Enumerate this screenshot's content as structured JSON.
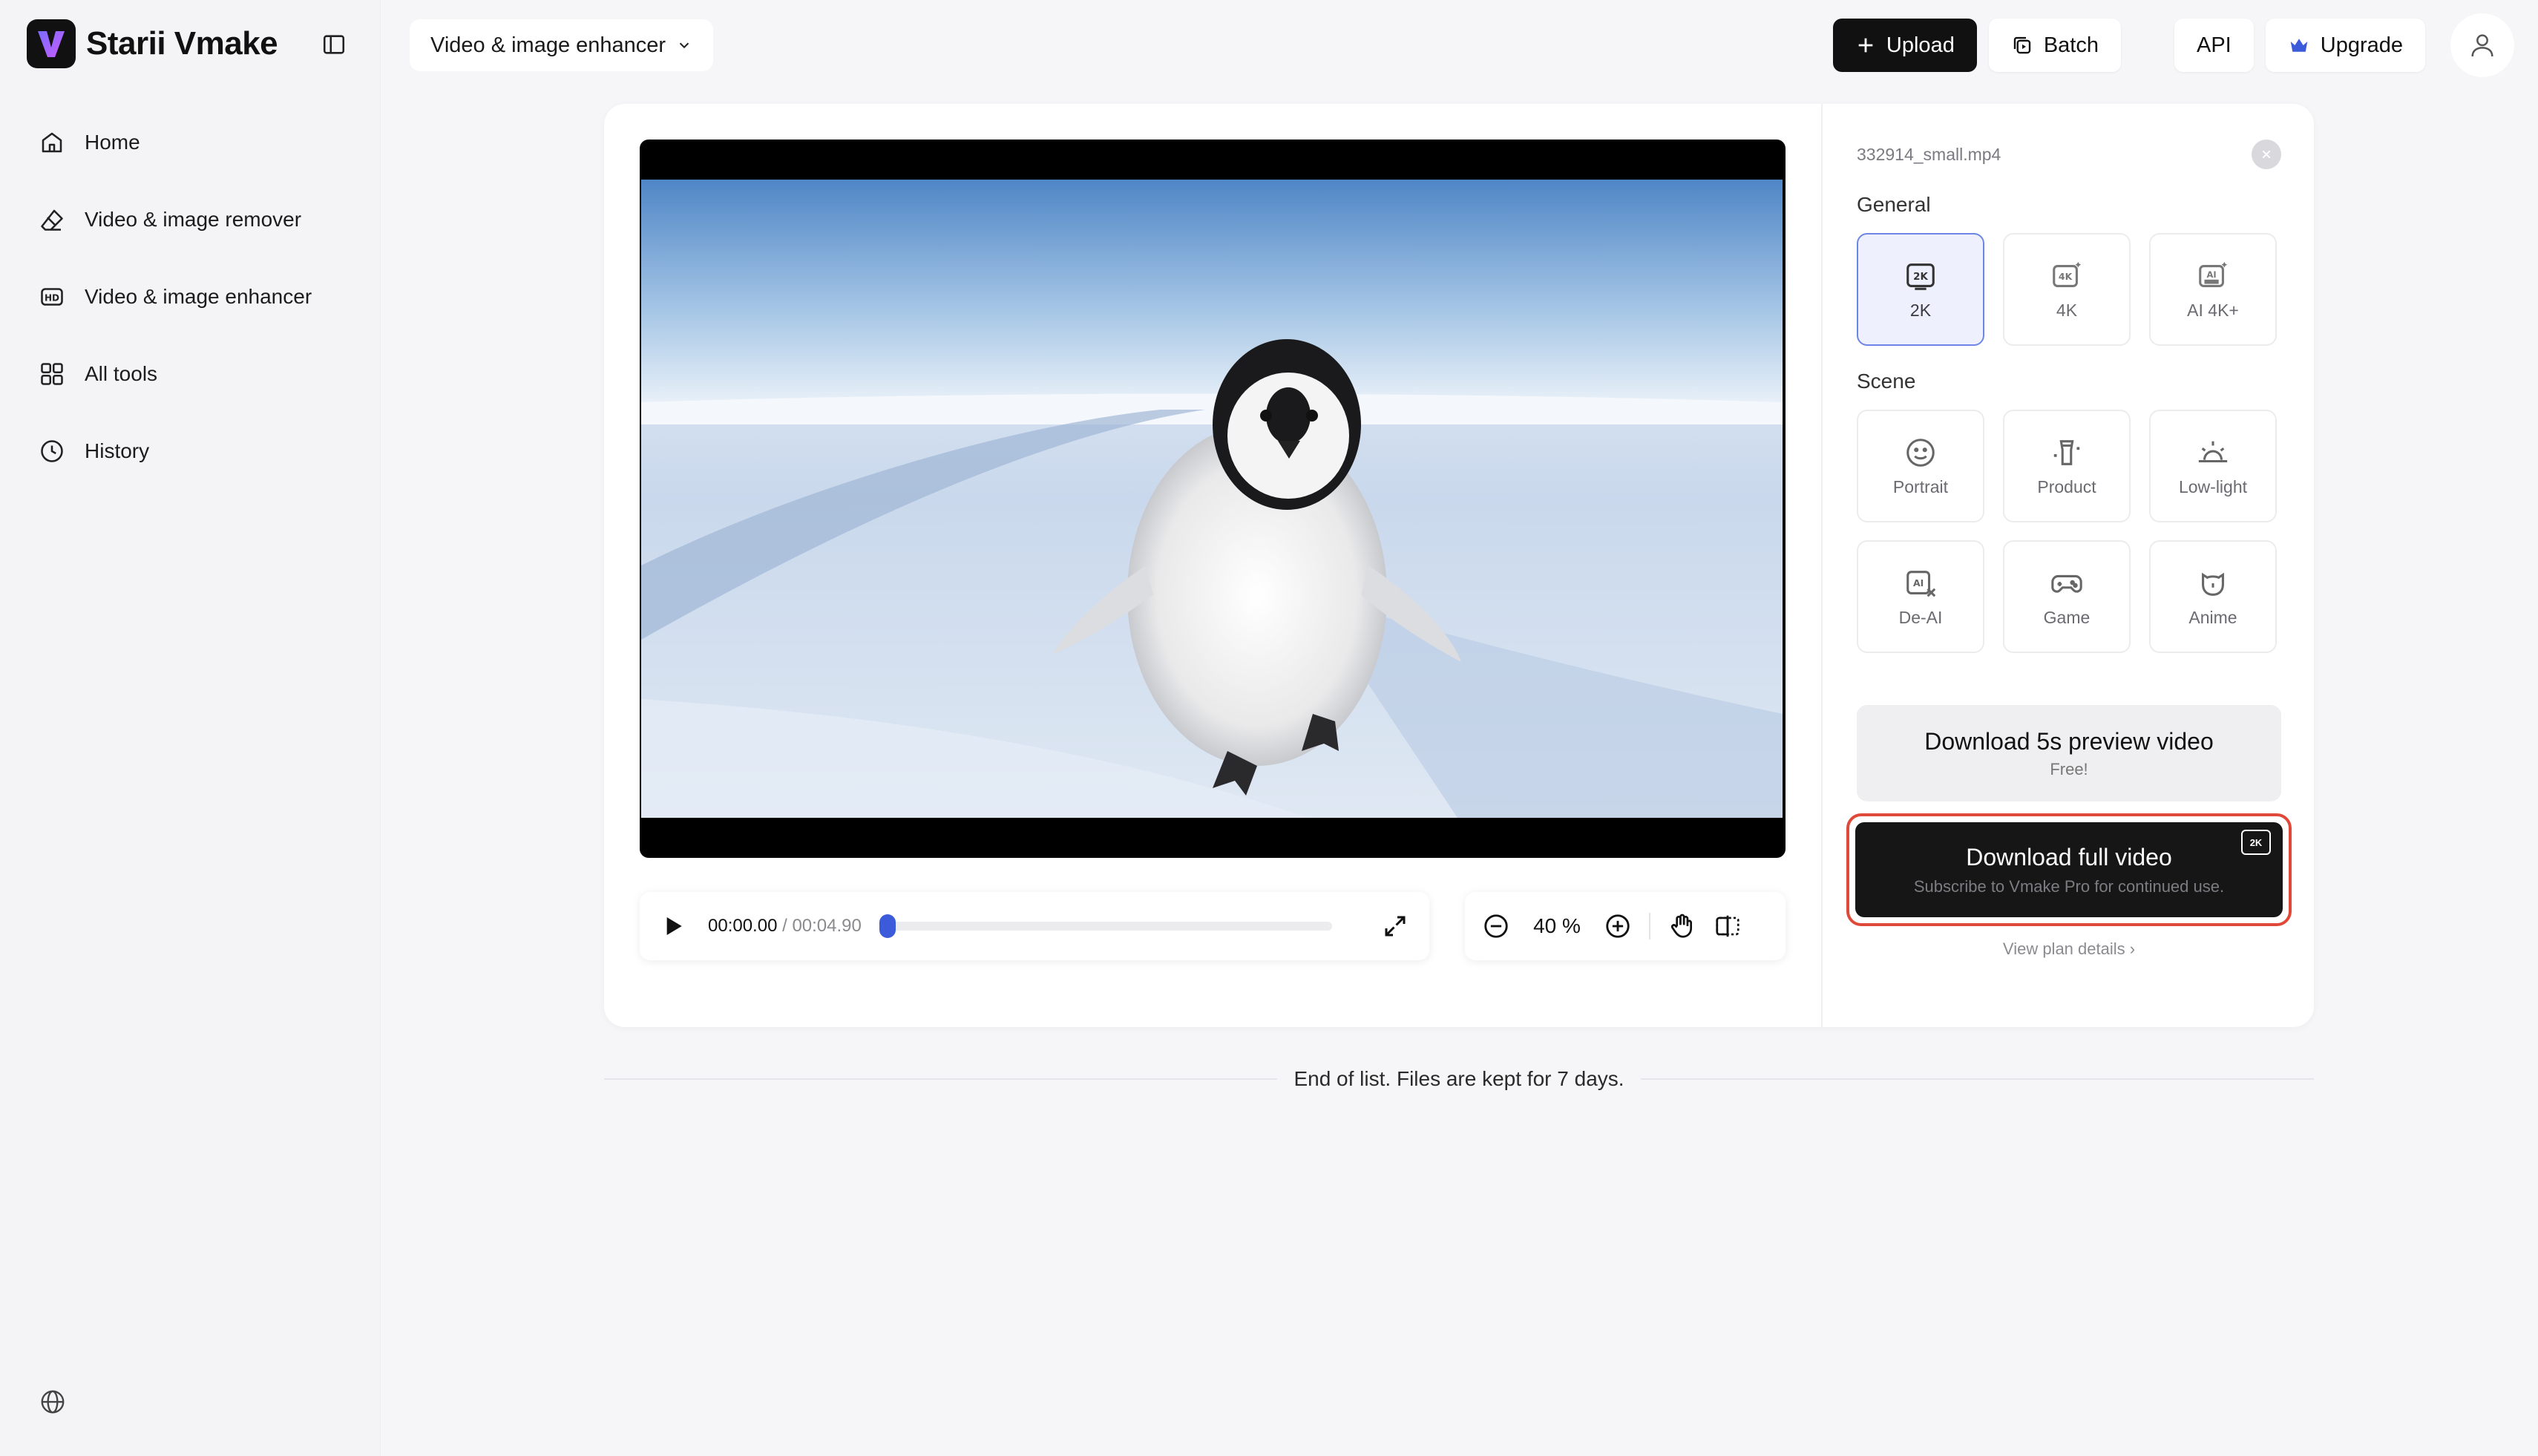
{
  "brand": {
    "name": "Starii Vmake",
    "logo_letter": "V"
  },
  "sidebar": {
    "items": [
      {
        "label": "Home",
        "icon": "home-icon"
      },
      {
        "label": "Video & image remover",
        "icon": "eraser-icon"
      },
      {
        "label": "Video & image enhancer",
        "icon": "hd-icon"
      },
      {
        "label": "All tools",
        "icon": "grid-icon"
      },
      {
        "label": "History",
        "icon": "clock-icon"
      }
    ]
  },
  "toolbar": {
    "tool_select": "Video & image enhancer",
    "upload_label": "Upload",
    "batch_label": "Batch",
    "api_label": "API",
    "upgrade_label": "Upgrade"
  },
  "player": {
    "current_time": "00:00.00",
    "separator": "/",
    "duration": "00:04.90",
    "progress": 0.0,
    "zoom": "40 %"
  },
  "panel": {
    "file_name": "332914_small.mp4",
    "general_title": "General",
    "general_options": [
      {
        "label": "2K",
        "icon": "2k-icon",
        "selected": true
      },
      {
        "label": "4K",
        "icon": "4k-icon",
        "selected": false
      },
      {
        "label": "AI 4K+",
        "icon": "ai-ultra-icon",
        "selected": false
      }
    ],
    "scene_title": "Scene",
    "scene_options": [
      {
        "label": "Portrait",
        "icon": "smile-icon"
      },
      {
        "label": "Product",
        "icon": "product-icon"
      },
      {
        "label": "Low-light",
        "icon": "sunrise-icon"
      },
      {
        "label": "De-AI",
        "icon": "de-ai-icon"
      },
      {
        "label": "Game",
        "icon": "gamepad-icon"
      },
      {
        "label": "Anime",
        "icon": "bear-icon"
      }
    ],
    "preview_button": {
      "title": "Download 5s preview video",
      "subtitle": "Free!"
    },
    "full_button": {
      "title": "Download full video",
      "subtitle": "Subscribe to Vmake Pro for continued use.",
      "badge": "2K"
    },
    "plan_link": "View plan details ›"
  },
  "footer": {
    "end_text": "End of list. Files are kept for 7 days."
  },
  "colors": {
    "accent": "#3b5bdb",
    "highlight": "#e0483a",
    "selected_border": "#6f86e8"
  }
}
